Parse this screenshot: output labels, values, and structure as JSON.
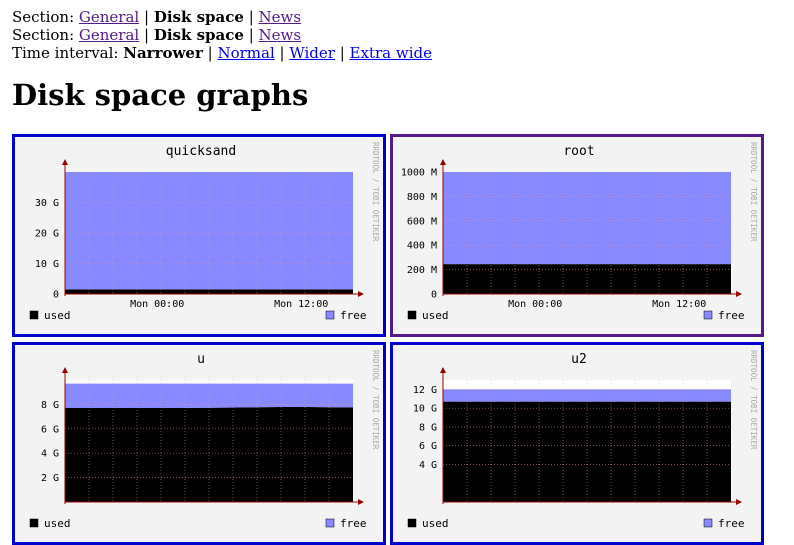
{
  "nav": {
    "rows": [
      {
        "label": "Section:",
        "items": [
          {
            "text": "General",
            "link": true,
            "visited": true
          },
          {
            "text": "Disk space",
            "link": false
          },
          {
            "text": "News",
            "link": true,
            "visited": true
          }
        ]
      },
      {
        "label": "Section:",
        "items": [
          {
            "text": "General",
            "link": true,
            "visited": true
          },
          {
            "text": "Disk space",
            "link": false
          },
          {
            "text": "News",
            "link": true,
            "visited": true
          }
        ]
      },
      {
        "label": "Time interval:",
        "items": [
          {
            "text": "Narrower",
            "link": false
          },
          {
            "text": "Normal",
            "link": true,
            "visited": false
          },
          {
            "text": "Wider",
            "link": true,
            "visited": false
          },
          {
            "text": "Extra wide",
            "link": true,
            "visited": false
          }
        ]
      }
    ]
  },
  "page_title": "Disk space graphs",
  "watermark": "RRDTOOL / TOBI OETIKER",
  "legend": {
    "used": "used",
    "free": "free"
  },
  "colors": {
    "used": "#000000",
    "free": "#8888ff",
    "link": "#0000ee",
    "visited": "#551a8b"
  },
  "chart_data": [
    {
      "type": "area",
      "title": "quicksand",
      "x_ticks": [
        "Mon 00:00",
        "Mon 12:00"
      ],
      "y_ticks": [
        {
          "v": 0,
          "label": "0"
        },
        {
          "v": 10,
          "label": "10 G"
        },
        {
          "v": 20,
          "label": "20 G"
        },
        {
          "v": 30,
          "label": "30 G"
        }
      ],
      "ylim": [
        0,
        40
      ],
      "series": [
        {
          "name": "used",
          "values": [
            1.5,
            1.5,
            1.5,
            1.5
          ]
        },
        {
          "name": "free",
          "values": [
            38.5,
            38.5,
            38.5,
            38.5
          ]
        }
      ]
    },
    {
      "type": "area",
      "title": "root",
      "x_ticks": [
        "Mon 00:00",
        "Mon 12:00"
      ],
      "y_ticks": [
        {
          "v": 0,
          "label": "0"
        },
        {
          "v": 200,
          "label": "200 M"
        },
        {
          "v": 400,
          "label": "400 M"
        },
        {
          "v": 600,
          "label": "600 M"
        },
        {
          "v": 800,
          "label": "800 M"
        },
        {
          "v": 1000,
          "label": "1000 M"
        }
      ],
      "ylim": [
        0,
        1000
      ],
      "series": [
        {
          "name": "used",
          "values": [
            245,
            245,
            245,
            245
          ]
        },
        {
          "name": "free",
          "values": [
            755,
            755,
            755,
            755
          ]
        }
      ]
    },
    {
      "type": "area",
      "title": "u",
      "x_ticks": [],
      "y_ticks": [
        {
          "v": 2,
          "label": "2 G"
        },
        {
          "v": 4,
          "label": "4 G"
        },
        {
          "v": 6,
          "label": "6 G"
        },
        {
          "v": 8,
          "label": "8 G"
        }
      ],
      "ylim": [
        0,
        10
      ],
      "series": [
        {
          "name": "used",
          "values": [
            7.7,
            7.7,
            7.7,
            7.75,
            7.8,
            7.75
          ]
        },
        {
          "name": "free",
          "values": [
            2.0,
            2.0,
            2.0,
            1.95,
            1.9,
            1.95
          ]
        }
      ]
    },
    {
      "type": "area",
      "title": "u2",
      "x_ticks": [],
      "y_ticks": [
        {
          "v": 4,
          "label": "4 G"
        },
        {
          "v": 6,
          "label": "6 G"
        },
        {
          "v": 8,
          "label": "8 G"
        },
        {
          "v": 10,
          "label": "10 G"
        },
        {
          "v": 12,
          "label": "12 G"
        }
      ],
      "ylim": [
        0,
        13
      ],
      "series": [
        {
          "name": "used",
          "values": [
            10.7,
            10.7,
            10.7,
            10.7
          ]
        },
        {
          "name": "free",
          "values": [
            1.3,
            1.3,
            1.3,
            1.3
          ]
        }
      ]
    }
  ]
}
